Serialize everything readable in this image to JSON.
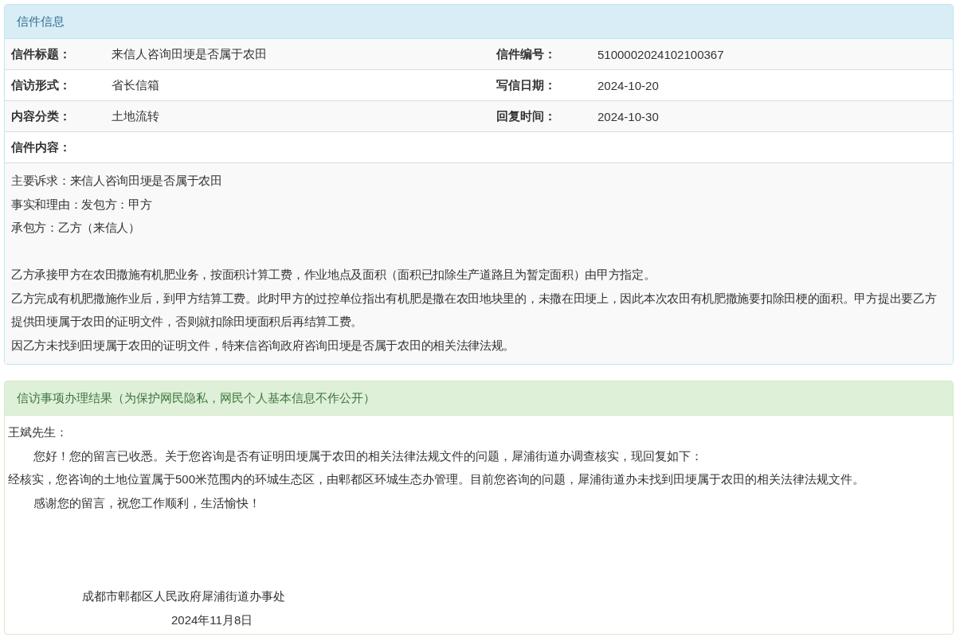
{
  "letter_info": {
    "title": "信件信息",
    "rows": [
      [
        {
          "label": "信件标题：",
          "value": "来信人咨询田埂是否属于农田"
        },
        {
          "label": "信件编号：",
          "value": "5100002024102100367"
        }
      ],
      [
        {
          "label": "信访形式：",
          "value": "省长信箱"
        },
        {
          "label": "写信日期：",
          "value": "2024-10-20"
        }
      ],
      [
        {
          "label": "内容分类：",
          "value": "土地流转"
        },
        {
          "label": "回复时间：",
          "value": "2024-10-30"
        }
      ],
      [
        {
          "label": "信件内容："
        }
      ]
    ],
    "content": {
      "summary": [
        "主要诉求：来信人咨询田埂是否属于农田",
        "事实和理由：发包方：甲方",
        "承包方：乙方（来信人）"
      ],
      "details": [
        "乙方承接甲方在农田撒施有机肥业务，按面积计算工费，作业地点及面积（面积已扣除生产道路且为暂定面积）由甲方指定。",
        "乙方完成有机肥撒施作业后，到甲方结算工费。此时甲方的过控单位指出有机肥是撒在农田地块里的，未撒在田埂上，因此本次农田有机肥撒施要扣除田梗的面积。甲方提出要乙方提供田埂属于农田的证明文件，否则就扣除田埂面积后再结算工费。",
        "因乙方未找到田埂属于农田的证明文件，特来信咨询政府咨询田埂是否属于农田的相关法律法规。"
      ]
    }
  },
  "result": {
    "title": "信访事项办理结果（为保护网民隐私，网民个人基本信息不作公开）",
    "lines": [
      {
        "kind": "plain",
        "text": "王斌先生："
      },
      {
        "kind": "indent",
        "text": "您好！您的留言已收悉。关于您咨询是否有证明田埂属于农田的相关法律法规文件的问题，犀浦街道办调查核实，现回复如下："
      },
      {
        "kind": "plain",
        "text": "经核实，您咨询的土地位置属于500米范围内的环城生态区，由郫都区环城生态办管理。目前您咨询的问题，犀浦街道办未找到田埂属于农田的相关法律法规文件。"
      },
      {
        "kind": "indent",
        "text": "感谢您的留言，祝您工作顺利，生活愉快！"
      }
    ],
    "signature": {
      "office": "成都市郫都区人民政府犀浦街道办事处",
      "date": "2024年11月8日"
    }
  }
}
